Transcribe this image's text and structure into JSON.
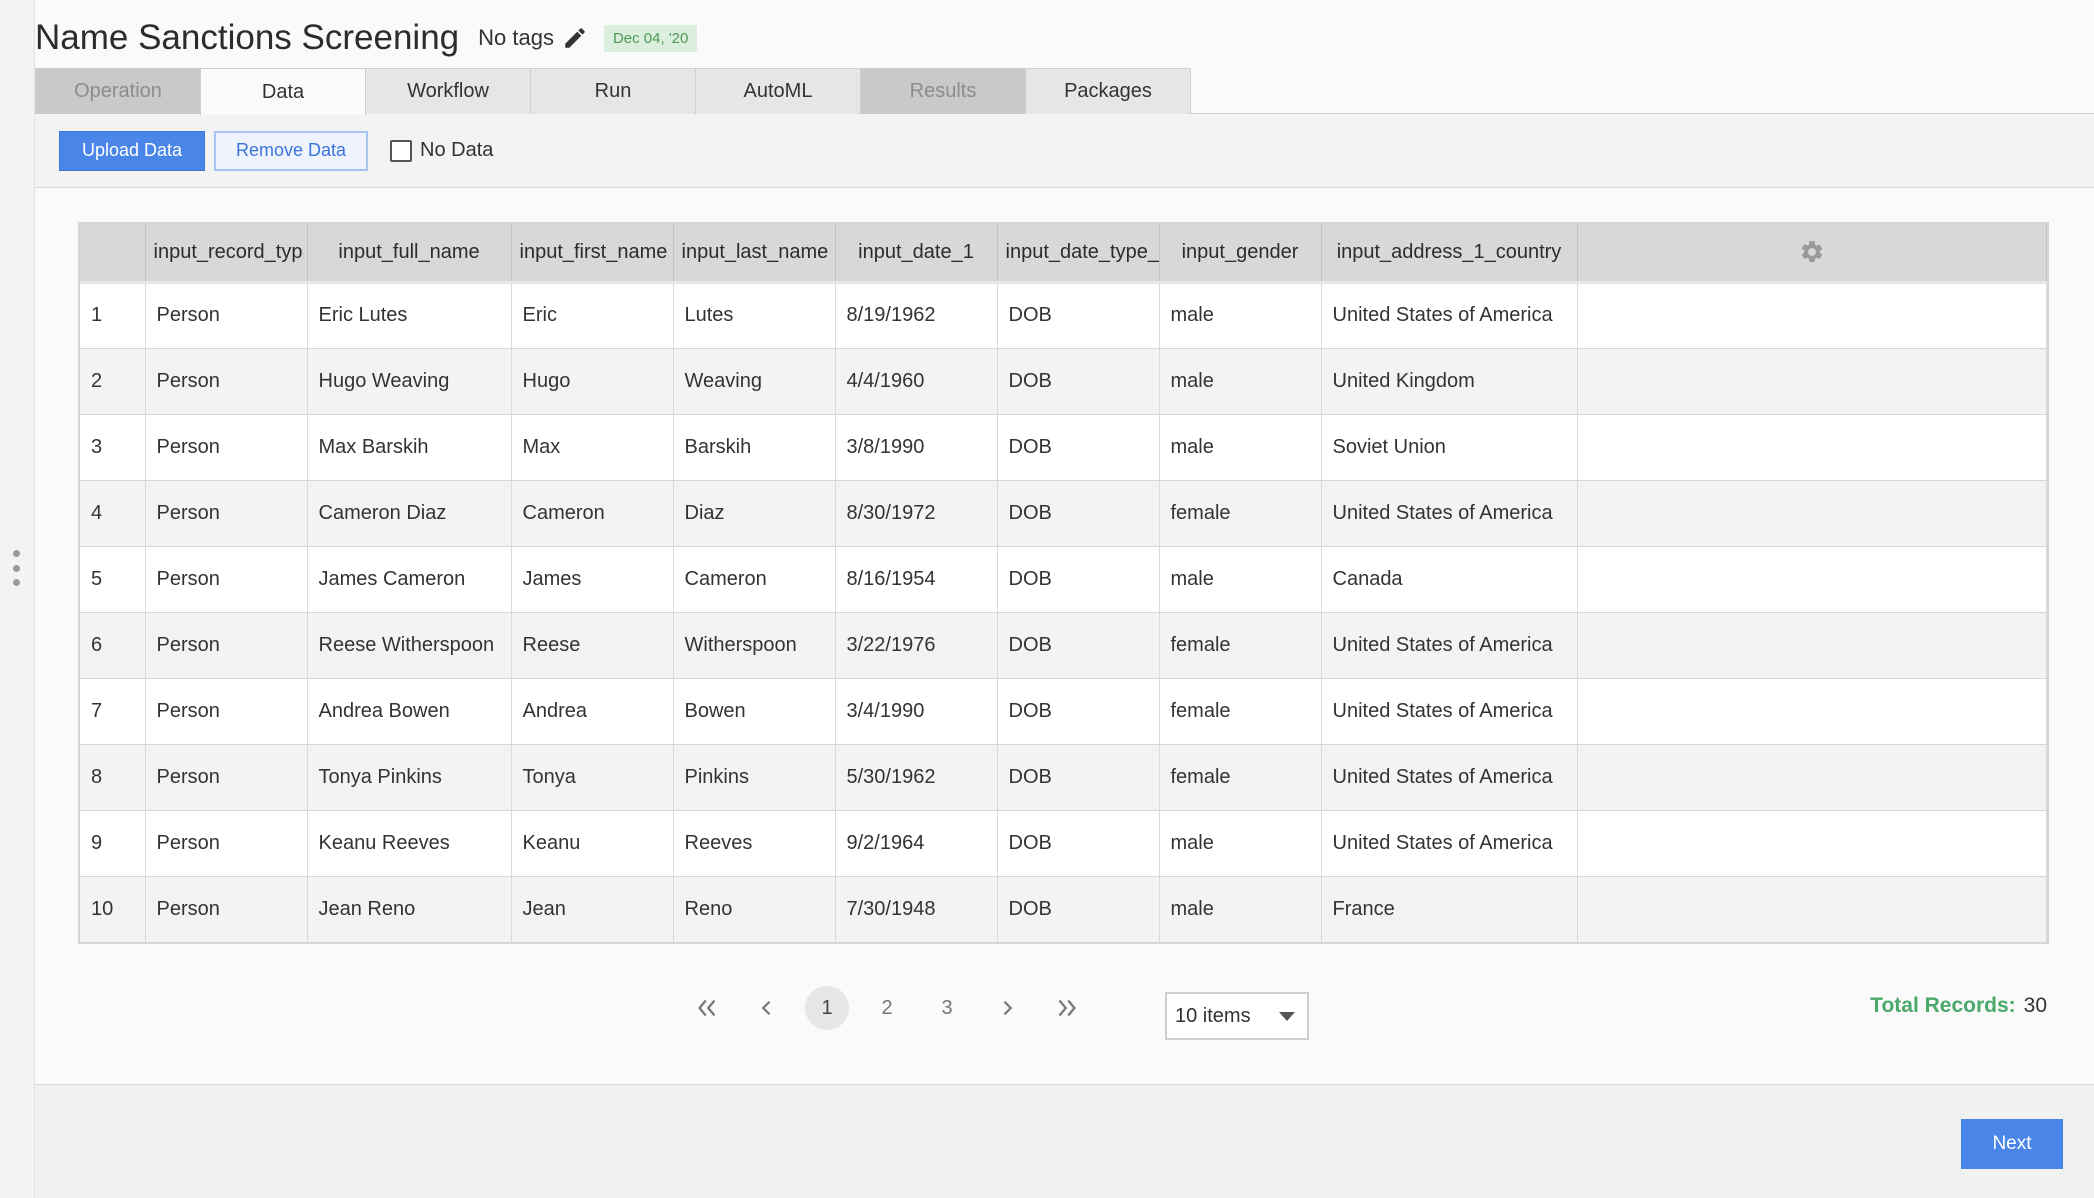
{
  "header": {
    "title": "Name Sanctions Screening",
    "tags": "No tags",
    "date_badge": "Dec 04, '20"
  },
  "tabs": [
    {
      "label": "Operation",
      "state": "disabled"
    },
    {
      "label": "Data",
      "state": "active"
    },
    {
      "label": "Workflow",
      "state": "normal"
    },
    {
      "label": "Run",
      "state": "normal"
    },
    {
      "label": "AutoML",
      "state": "normal"
    },
    {
      "label": "Results",
      "state": "disabled"
    },
    {
      "label": "Packages",
      "state": "normal"
    }
  ],
  "toolbar": {
    "upload_label": "Upload Data",
    "remove_label": "Remove Data",
    "no_data_label": "No Data"
  },
  "table": {
    "columns": [
      "",
      "input_record_typ",
      "input_full_name",
      "input_first_name",
      "input_last_name",
      "input_date_1",
      "input_date_type_",
      "input_gender",
      "input_address_1_country"
    ],
    "rows": [
      [
        "1",
        "Person",
        "Eric Lutes",
        "Eric",
        "Lutes",
        "8/19/1962",
        "DOB",
        "male",
        "United States of America"
      ],
      [
        "2",
        "Person",
        "Hugo Weaving",
        "Hugo",
        "Weaving",
        "4/4/1960",
        "DOB",
        "male",
        "United Kingdom"
      ],
      [
        "3",
        "Person",
        "Max Barskih",
        "Max",
        "Barskih",
        "3/8/1990",
        "DOB",
        "male",
        "Soviet Union"
      ],
      [
        "4",
        "Person",
        "Cameron Diaz",
        "Cameron",
        "Diaz",
        "8/30/1972",
        "DOB",
        "female",
        "United States of America"
      ],
      [
        "5",
        "Person",
        "James Cameron",
        "James",
        "Cameron",
        "8/16/1954",
        "DOB",
        "male",
        "Canada"
      ],
      [
        "6",
        "Person",
        "Reese Witherspoon",
        "Reese",
        "Witherspoon",
        "3/22/1976",
        "DOB",
        "female",
        "United States of America"
      ],
      [
        "7",
        "Person",
        "Andrea Bowen",
        "Andrea",
        "Bowen",
        "3/4/1990",
        "DOB",
        "female",
        "United States of America"
      ],
      [
        "8",
        "Person",
        "Tonya Pinkins",
        "Tonya",
        "Pinkins",
        "5/30/1962",
        "DOB",
        "female",
        "United States of America"
      ],
      [
        "9",
        "Person",
        "Keanu Reeves",
        "Keanu",
        "Reeves",
        "9/2/1964",
        "DOB",
        "male",
        "United States of America"
      ],
      [
        "10",
        "Person",
        "Jean Reno",
        "Jean",
        "Reno",
        "7/30/1948",
        "DOB",
        "male",
        "France"
      ]
    ]
  },
  "pagination": {
    "pages": [
      "1",
      "2",
      "3"
    ],
    "current": "1",
    "page_size": "10 items"
  },
  "total": {
    "label": "Total Records:",
    "value": "30"
  },
  "footer": {
    "next_label": "Next"
  },
  "colors": {
    "accent": "#4a86e8",
    "total_label": "#4aa86a",
    "badge_bg": "#dceedd",
    "badge_text": "#4d9a57"
  }
}
